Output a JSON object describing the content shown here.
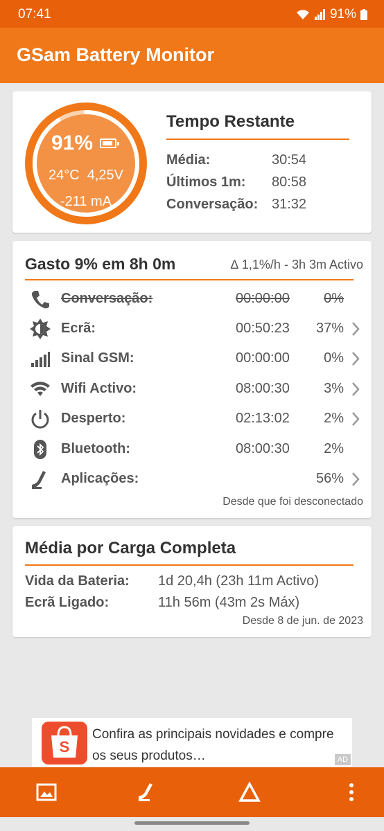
{
  "status_bar": {
    "time": "07:41",
    "battery": "91%"
  },
  "app": {
    "title": "GSam Battery Monitor"
  },
  "gauge": {
    "percent": "91%",
    "temp_voltage": "24°C  4,25V",
    "current": "-211 mA",
    "level": 0.91
  },
  "time_remaining": {
    "title": "Tempo Restante",
    "rows": [
      {
        "label": "Média:",
        "value": "30:54"
      },
      {
        "label": "Últimos 1m:",
        "value": "80:58"
      },
      {
        "label": "Conversação:",
        "value": "31:32"
      }
    ]
  },
  "usage": {
    "title": "Gasto 9% em 8h 0m",
    "rate": "∆ 1,1%/h - 3h 3m Activo",
    "rows": [
      {
        "label": "Conversação:",
        "time": "00:00:00",
        "percent": "0%",
        "icon": "phone-icon"
      },
      {
        "label": "Ecrã:",
        "time": "00:50:23",
        "percent": "37%",
        "icon": "brightness-icon"
      },
      {
        "label": "Sinal GSM:",
        "time": "00:00:00",
        "percent": "0%",
        "icon": "signal-icon"
      },
      {
        "label": "Wifi Activo:",
        "time": "08:00:30",
        "percent": "3%",
        "icon": "wifi-icon"
      },
      {
        "label": "Desperto:",
        "time": "02:13:02",
        "percent": "2%",
        "icon": "power-icon"
      },
      {
        "label": "Bluetooth:",
        "time": "08:00:30",
        "percent": "2%",
        "icon": "bluetooth-icon"
      },
      {
        "label": "Aplicações:",
        "time": "",
        "percent": "56%",
        "icon": "apps-gauge-icon"
      }
    ],
    "footer": "Desde que foi desconectado"
  },
  "full_charge": {
    "title": "Média por Carga Completa",
    "rows": [
      {
        "label": "Vida da Bateria:",
        "value": "1d 20,4h (23h 11m Activo)"
      },
      {
        "label": "Ecrã Ligado:",
        "value": "11h 56m (43m 2s Máx)"
      }
    ],
    "footer": "Desde 8 de jun. de 2023"
  },
  "ad": {
    "text": "Confira as principais novidades e compre os seus produtos…",
    "tag": "AD"
  },
  "colors": {
    "accent": "#f07818",
    "status": "#e8600a"
  }
}
